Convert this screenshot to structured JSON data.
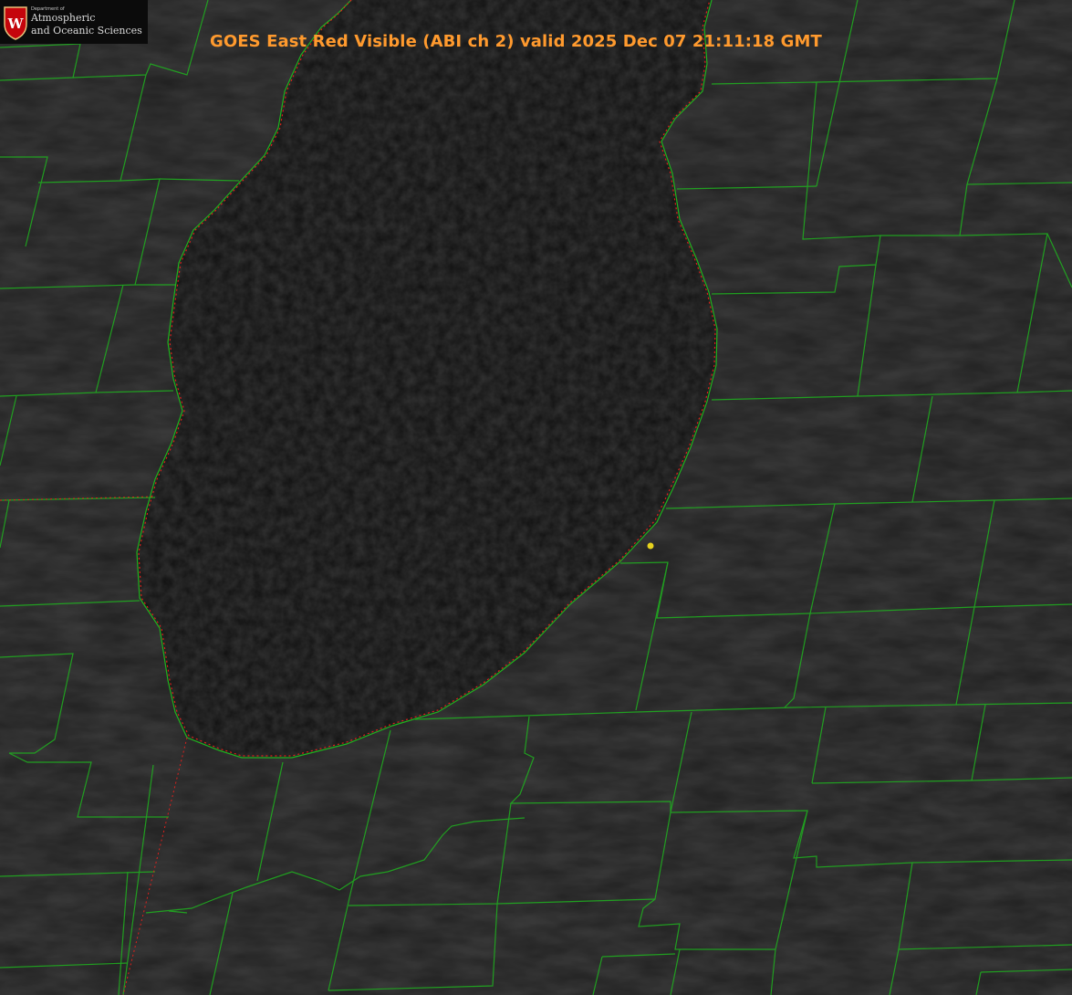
{
  "title": "GOES East Red Visible (ABI ch 2) valid 2025 Dec 07 21:11:18 GMT",
  "logo": {
    "department": "Department of",
    "line1": "Atmospheric",
    "line2": "and Oceanic Sciences",
    "emblem_icon": "uw-crest-icon"
  },
  "colors": {
    "title": "#ff9a2e",
    "county_lines": "#1fb31f",
    "lake_outline": "#e0201c",
    "marker": "#e6d21e",
    "land": "#202020",
    "lake": "#0f0f0f"
  }
}
